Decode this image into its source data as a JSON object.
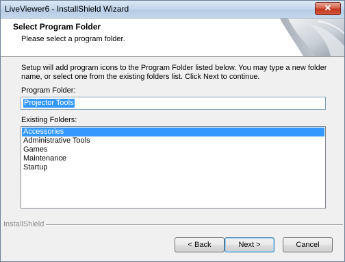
{
  "window": {
    "title": "LiveViewer6 - InstallShield Wizard",
    "close_glyph": "✕"
  },
  "header": {
    "title": "Select Program Folder",
    "subtitle": "Please select a program folder."
  },
  "body": {
    "intro": "Setup will add program icons to the Program Folder listed below.  You may type a new folder name, or select one from the existing folders list.  Click Next to continue.",
    "program_folder_label": "Program Folder:",
    "program_folder_value": "Projector Tools",
    "existing_folders_label": "Existing Folders:",
    "folders": [
      {
        "label": "Accessories",
        "selected": true
      },
      {
        "label": "Administrative Tools",
        "selected": false
      },
      {
        "label": "Games",
        "selected": false
      },
      {
        "label": "Maintenance",
        "selected": false
      },
      {
        "label": "Startup",
        "selected": false
      }
    ]
  },
  "footer": {
    "brand": "InstallShield",
    "back_label": "< Back",
    "next_label": "Next >",
    "cancel_label": "Cancel"
  },
  "colors": {
    "selection": "#3399ff",
    "close_button": "#c2361c"
  }
}
